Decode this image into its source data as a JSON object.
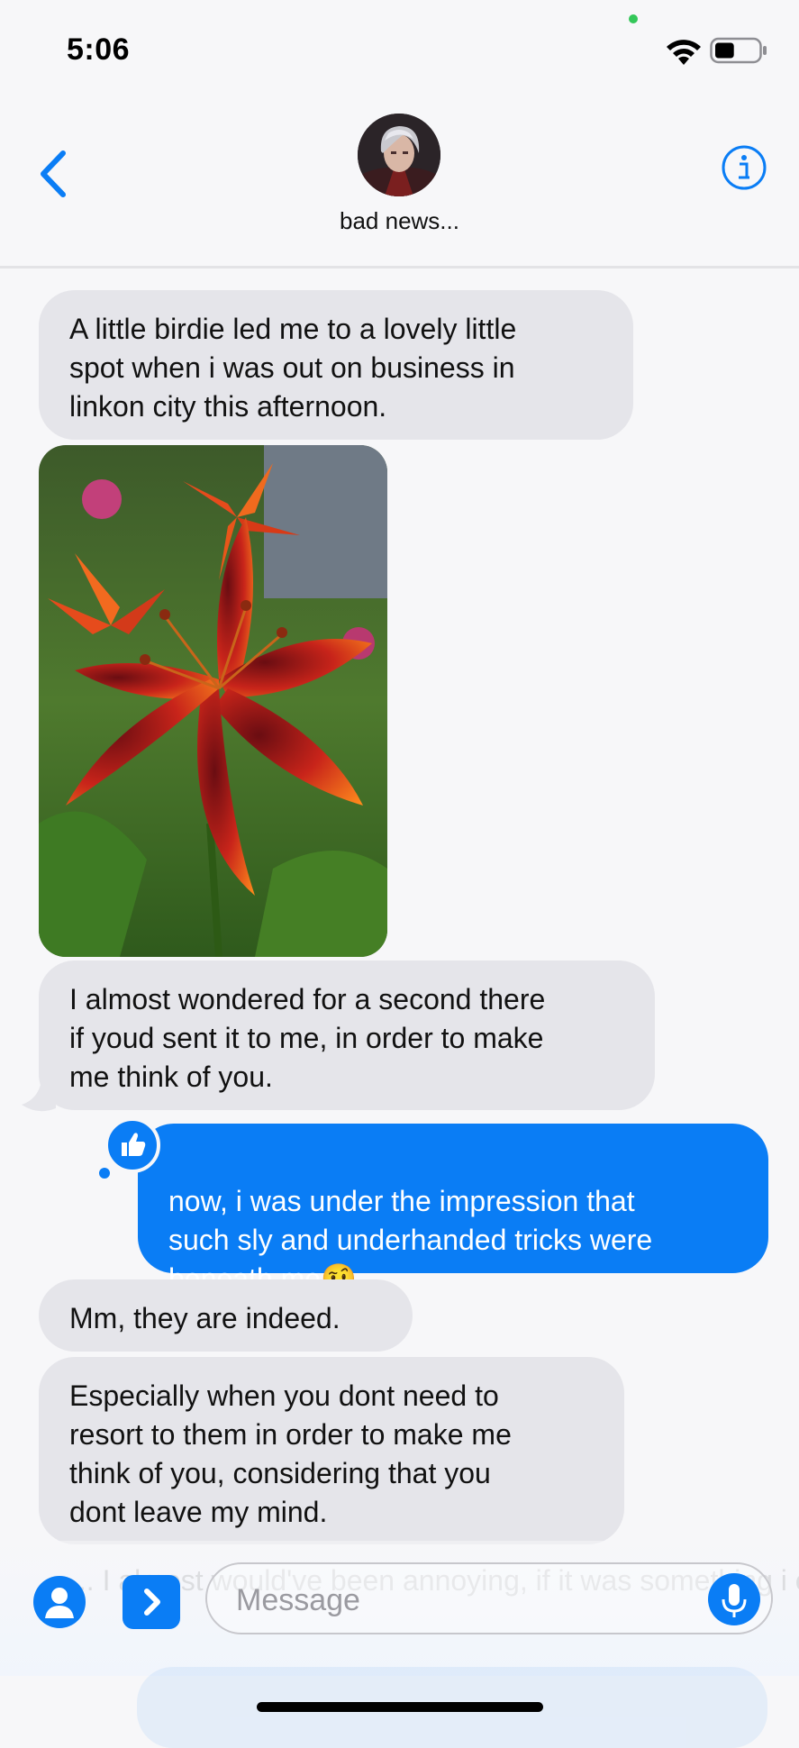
{
  "status_bar": {
    "time": "5:06",
    "battery_level": 0.45
  },
  "header": {
    "contact_name": "bad news...",
    "back_icon": "chevron-left-icon",
    "info_icon": "info-circle-icon"
  },
  "colors": {
    "accent": "#0a7df5",
    "incoming_bubble": "#e5e5ea",
    "background": "#f7f7f9"
  },
  "messages": [
    {
      "direction": "incoming",
      "text": "A little birdie led me to a lovely little\nspot when i was out on business in\nlinkon city this afternoon."
    },
    {
      "direction": "incoming",
      "type": "image",
      "description": "orange lily photo"
    },
    {
      "direction": "incoming",
      "text": "I almost wondered for a second there\nif youd sent it to me, in order to make\nme think of you."
    },
    {
      "direction": "outgoing",
      "text": "now, i was under the impression that\nsuch sly and underhanded tricks were\nbeneath me",
      "emoji": "🤨",
      "reaction": "thumbs-up-icon"
    },
    {
      "direction": "incoming",
      "text": "Mm, they are indeed."
    },
    {
      "direction": "incoming",
      "text": "Especially when you dont need to\nresort to them in order to make me\nthink of you, considering that you\ndont leave my mind."
    }
  ],
  "compose": {
    "placeholder": "Message",
    "ghost_text": "... I almost would've been annoying, if it was something i enjoyed",
    "app_icon": "app-store-icon",
    "expand_icon": "chevron-right-icon",
    "mic_icon": "microphone-icon"
  }
}
